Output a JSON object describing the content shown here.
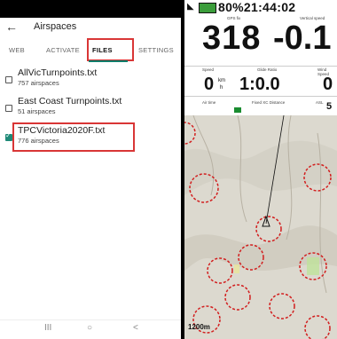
{
  "left": {
    "appbar": {
      "title": "Airspaces"
    },
    "tabs": [
      "WEB",
      "ACTIVATE",
      "FILES",
      "SETTINGS"
    ],
    "files": [
      {
        "name": "AllVicTurnpoints.txt",
        "count": "757 airspaces",
        "checked": false
      },
      {
        "name": "East Coast Turnpoints.txt",
        "count": "51 airspaces",
        "checked": false
      },
      {
        "name": "TPCVictoria2020F.txt",
        "count": "776 airspaces",
        "checked": true
      }
    ],
    "nav": [
      "III",
      "○",
      "<"
    ]
  },
  "right": {
    "status": "80%21:44:02",
    "labels": {
      "gps": "GPS fix",
      "vertical_speed": "Vertical speed",
      "speed": "Speed",
      "glide_ratio": "Glide Ratio",
      "wind": "Wind Speed",
      "air_time": "Air time",
      "fixed_xc": "Fixed XC Distance",
      "asl": "ASL"
    },
    "speed": "318",
    "vario": "-0.1",
    "speed_val": "0",
    "speed_unit_top": "km",
    "speed_unit_bot": "h",
    "glide": "1:0.0",
    "wind_val": "0",
    "asl_val": "5",
    "map_scale": "1200m"
  }
}
